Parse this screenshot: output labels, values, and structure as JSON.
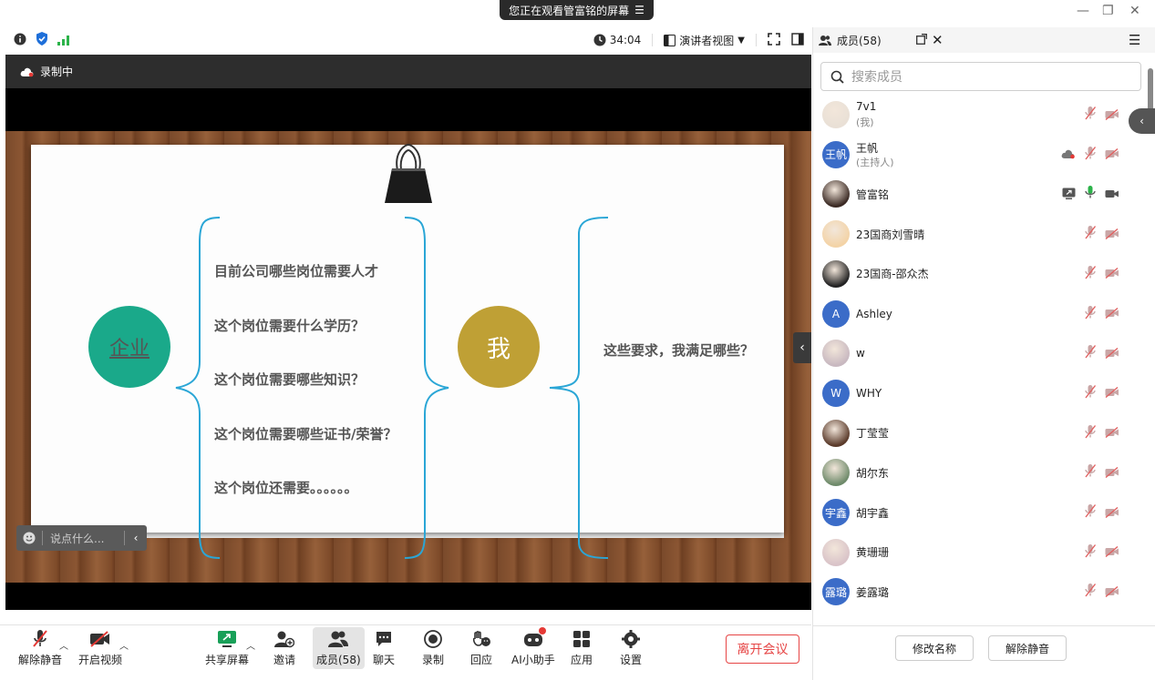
{
  "banner": {
    "text": "您正在观看管富铭的屏幕",
    "menu_icon": "menu-icon"
  },
  "window": {
    "minimize": "—",
    "restore": "❐",
    "close": "✕"
  },
  "topbar": {
    "timer": "34:04",
    "view_label": "演讲者视图",
    "status_icons": [
      "info-icon",
      "shield-icon",
      "signal-icon"
    ]
  },
  "recording": {
    "label": "录制中"
  },
  "slide": {
    "left_circle": "企业",
    "right_circle": "我",
    "questions": [
      "目前公司哪些岗位需要人才",
      "这个岗位需要什么学历？",
      "这个岗位需要哪些知识？",
      "这个岗位需要哪些证书/荣誉？",
      "这个岗位还需要。。。。。。"
    ],
    "answer": "这些要求，我满足哪些？",
    "colors": {
      "green": "#1aa98a",
      "gold": "#bfa035",
      "brace": "#2aa6d6"
    }
  },
  "chat": {
    "placeholder": "说点什么..."
  },
  "toolbar": {
    "mute_label": "解除静音",
    "video_label": "开启视频",
    "share_label": "共享屏幕",
    "invite_label": "邀请",
    "members_label": "成员(58)",
    "chat_label": "聊天",
    "record_label": "录制",
    "react_label": "回应",
    "ai_label": "AI小助手",
    "apps_label": "应用",
    "settings_label": "设置",
    "leave_label": "离开会议"
  },
  "panel": {
    "title": "成员(58)",
    "search_placeholder": "搜索成员",
    "members": [
      {
        "name": "7v1",
        "role": "(我)",
        "avatar": "",
        "avatar_type": "photo",
        "mic": "muted",
        "cam": "off"
      },
      {
        "name": "王帆",
        "role": "(主持人)",
        "avatar": "王帆",
        "avatar_type": "text",
        "mic": "muted",
        "cam": "off",
        "cloud": true
      },
      {
        "name": "管富铭",
        "role": "",
        "avatar": "",
        "avatar_type": "photo",
        "mic": "on",
        "cam": "on",
        "sharing": true
      },
      {
        "name": "23国商刘雪晴",
        "role": "",
        "avatar": "",
        "avatar_type": "photo",
        "mic": "muted",
        "cam": "off"
      },
      {
        "name": "23国商-邵众杰",
        "role": "",
        "avatar": "",
        "avatar_type": "photo",
        "mic": "muted",
        "cam": "off"
      },
      {
        "name": "Ashley",
        "role": "",
        "avatar": "A",
        "avatar_type": "text",
        "mic": "muted",
        "cam": "off"
      },
      {
        "name": "w",
        "role": "",
        "avatar": "",
        "avatar_type": "photo",
        "mic": "muted",
        "cam": "off"
      },
      {
        "name": "WHY",
        "role": "",
        "avatar": "W",
        "avatar_type": "text",
        "mic": "muted",
        "cam": "off"
      },
      {
        "name": "丁莹莹",
        "role": "",
        "avatar": "",
        "avatar_type": "photo",
        "mic": "muted",
        "cam": "off"
      },
      {
        "name": "胡尔东",
        "role": "",
        "avatar": "",
        "avatar_type": "photo",
        "mic": "muted",
        "cam": "off"
      },
      {
        "name": "胡宇鑫",
        "role": "",
        "avatar": "宇鑫",
        "avatar_type": "text",
        "mic": "muted",
        "cam": "off"
      },
      {
        "name": "黄珊珊",
        "role": "",
        "avatar": "",
        "avatar_type": "photo",
        "mic": "muted",
        "cam": "off"
      },
      {
        "name": "姜露璐",
        "role": "",
        "avatar": "露璐",
        "avatar_type": "text",
        "mic": "muted",
        "cam": "off"
      }
    ],
    "rename_label": "修改名称",
    "unmute_all_label": "解除静音"
  }
}
